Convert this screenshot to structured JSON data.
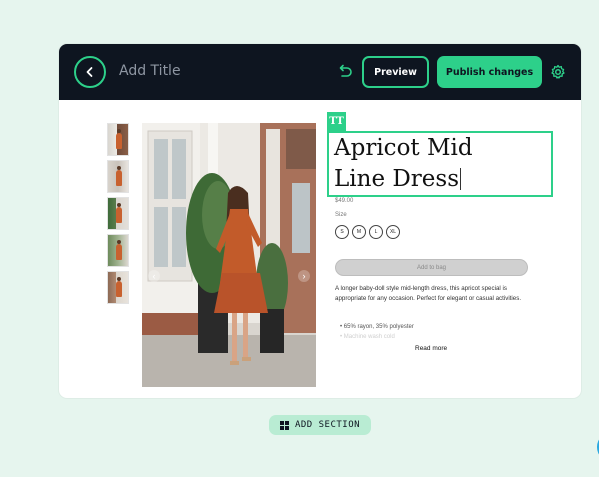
{
  "topbar": {
    "title_placeholder": "Add Title",
    "preview_label": "Preview",
    "publish_label": "Publish changes",
    "icons": [
      "chevron-left-icon",
      "undo-icon",
      "gear-icon"
    ]
  },
  "editor": {
    "text_tool_label": "TT",
    "product_title_line1": "Apricot Mid",
    "product_title_line2": "Line Dress",
    "price": "$49.00",
    "size_label": "Size",
    "sizes": [
      "S",
      "M",
      "L",
      "XL"
    ],
    "add_to_bag_label": "Add to bag",
    "description": "A longer baby-doll style mid-length dress, this apricot special is appropriate for any occasion. Perfect for elegant or casual activities.",
    "bullets": [
      "65% rayon, 35% polyester",
      "Machine wash cold"
    ],
    "read_more_label": "Read more"
  },
  "footer": {
    "add_section_label": "ADD SECTION"
  },
  "colors": {
    "accent": "#2dd08a",
    "topbar_bg": "#0e1520",
    "page_bg": "#e6f5ee"
  }
}
